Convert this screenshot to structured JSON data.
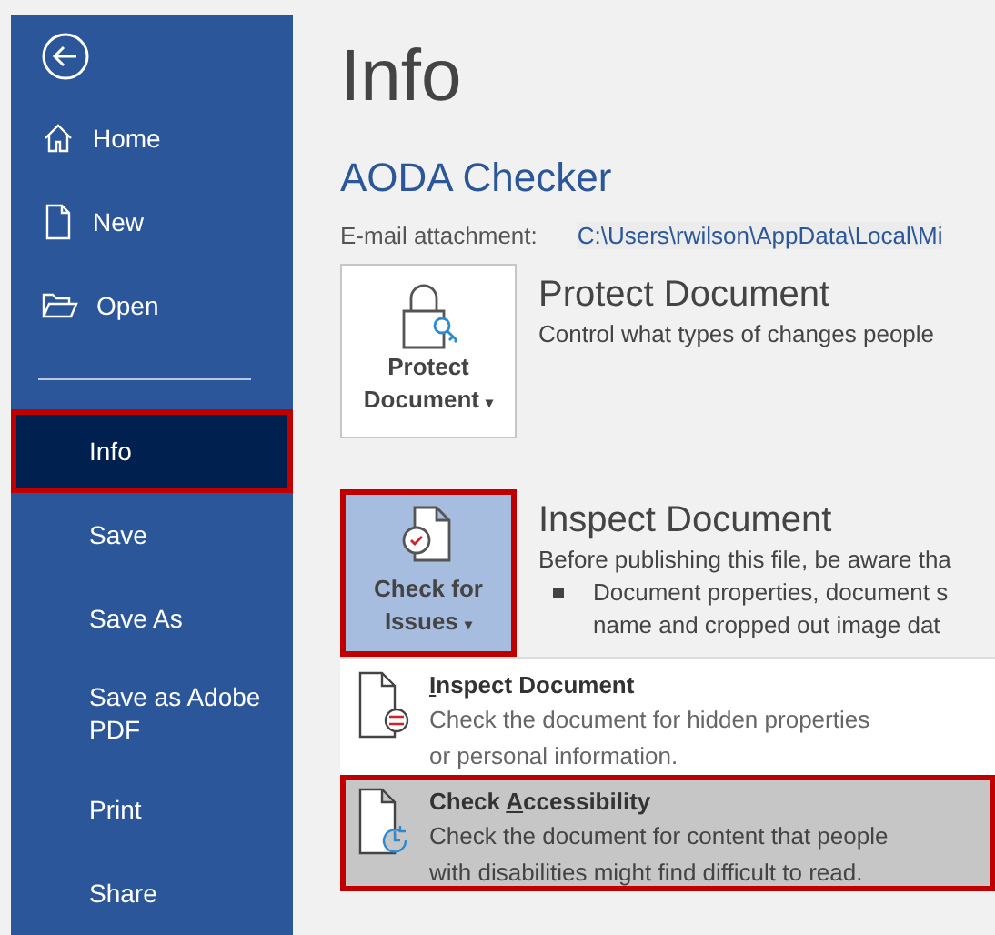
{
  "sidebar": {
    "items": [
      {
        "kind": "back",
        "selected": false,
        "outlined": false
      },
      {
        "kind": "home",
        "label": "Home",
        "selected": false,
        "outlined": false
      },
      {
        "kind": "new",
        "label": "New",
        "selected": false,
        "outlined": false
      },
      {
        "kind": "open",
        "label": "Open",
        "selected": false,
        "outlined": false
      },
      {
        "kind": "separator"
      },
      {
        "kind": "text",
        "label": "Info",
        "selected": true,
        "outlined": true
      },
      {
        "kind": "text",
        "label": "Save",
        "selected": false,
        "outlined": false
      },
      {
        "kind": "text",
        "label": "Save As",
        "selected": false,
        "outlined": false
      },
      {
        "kind": "text",
        "label": "Save as Adobe PDF",
        "selected": false,
        "outlined": false
      },
      {
        "kind": "text",
        "label": "Print",
        "selected": false,
        "outlined": false
      },
      {
        "kind": "text",
        "label": "Share",
        "selected": false,
        "outlined": false
      }
    ]
  },
  "page_title": "Info",
  "document_name": "AODA Checker",
  "location": {
    "label": "E-mail attachment:",
    "path": "C:\\Users\\rwilson\\AppData\\Local\\Mi"
  },
  "sections": [
    {
      "kind": "protect",
      "button": {
        "line1": "Protect",
        "line2": "Document",
        "caret": "▾",
        "outlined": false,
        "pressed": false
      },
      "title": "Protect Document",
      "text": "Control what types of changes people"
    },
    {
      "kind": "inspect",
      "button": {
        "line1": "Check for",
        "line2": "Issues",
        "caret": "▾",
        "outlined": true,
        "pressed": true
      },
      "title": "Inspect Document",
      "text": "Before publishing this file, be aware tha",
      "bullets": [
        [
          "Document properties, document s",
          "name and cropped out image dat"
        ]
      ]
    }
  ],
  "dropdown": {
    "items": [
      {
        "kind": "inspect",
        "label_parts": [
          {
            "text": "I",
            "underline": true
          },
          {
            "text": "nspect Document",
            "underline": false
          }
        ],
        "description": [
          "Check the document for hidden properties",
          "or personal information."
        ],
        "selected": false,
        "outlined": false
      },
      {
        "kind": "accessibility",
        "label_parts": [
          {
            "text": "Check ",
            "underline": false
          },
          {
            "text": "A",
            "underline": true
          },
          {
            "text": "ccessibility",
            "underline": false
          }
        ],
        "description": [
          "Check the document for content that people",
          "with disabilities might find difficult to read."
        ],
        "selected": true,
        "outlined": true
      }
    ]
  }
}
